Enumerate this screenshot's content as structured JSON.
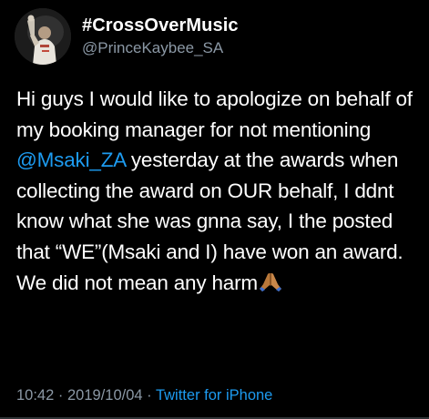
{
  "tweet": {
    "display_name": "#CrossOverMusic",
    "handle": "@PrinceKaybee_SA",
    "text_before": "Hi guys I would like to apologize on behalf of my booking manager for not mentioning ",
    "mention": "@Msaki_ZA",
    "text_after": " yesterday at the awards when collecting the award on OUR behalf, I ddnt know what she was gnna say, I the posted that “WE”(Msaki and I) have won an award. We did not mean any harm",
    "emoji": "pray-emoji",
    "time": "10:42",
    "separator": "·",
    "date": "2019/10/04",
    "source": "Twitter for iPhone"
  },
  "colors": {
    "background": "#000000",
    "text": "#ffffff",
    "secondary": "#8b98a5",
    "link": "#1d9bf0"
  }
}
